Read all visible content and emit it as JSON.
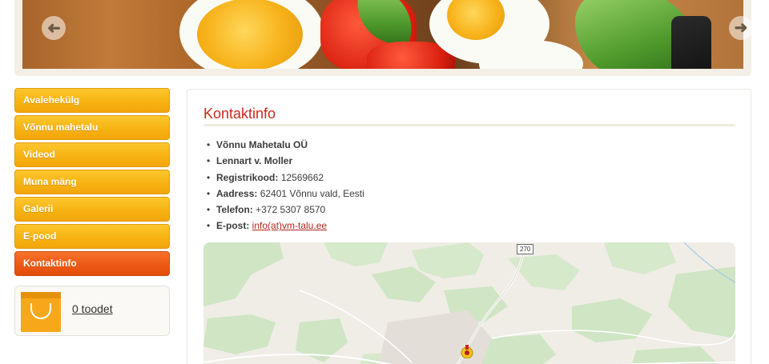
{
  "banner": {
    "prev_icon": "arrow-left-icon",
    "next_icon": "arrow-right-icon",
    "prev_glyph": "➜",
    "next_glyph": "➜"
  },
  "menu": {
    "items": [
      {
        "label": "Avalehekülg",
        "active": false
      },
      {
        "label": "Võnnu mahetalu",
        "active": false
      },
      {
        "label": "Videod",
        "active": false
      },
      {
        "label": "Muna mäng",
        "active": false
      },
      {
        "label": "Galerii",
        "active": false
      },
      {
        "label": "E-pood",
        "active": false
      },
      {
        "label": "Kontaktinfo",
        "active": true
      }
    ],
    "accent_color": "#f7b312",
    "active_color": "#ee5a14"
  },
  "cart": {
    "icon": "shopping-bag-icon",
    "label": "0 toodet"
  },
  "content": {
    "title": "Kontaktinfo",
    "company": "Võnnu Mahetalu OÜ",
    "person": "Lennart v. Moller",
    "regcode_label": "Registrikood:",
    "regcode_value": "12569662",
    "address_label": "Aadress:",
    "address_value": "62401 Võnnu vald, Eesti",
    "phone_label": "Telefon:",
    "phone_value": "+372 5307 8570",
    "email_label": "E-post:",
    "email_value": "info(at)vm-talu.ee",
    "title_color": "#c8281e"
  },
  "map": {
    "road_label": "270",
    "marker_icon": "map-marker-icon"
  }
}
